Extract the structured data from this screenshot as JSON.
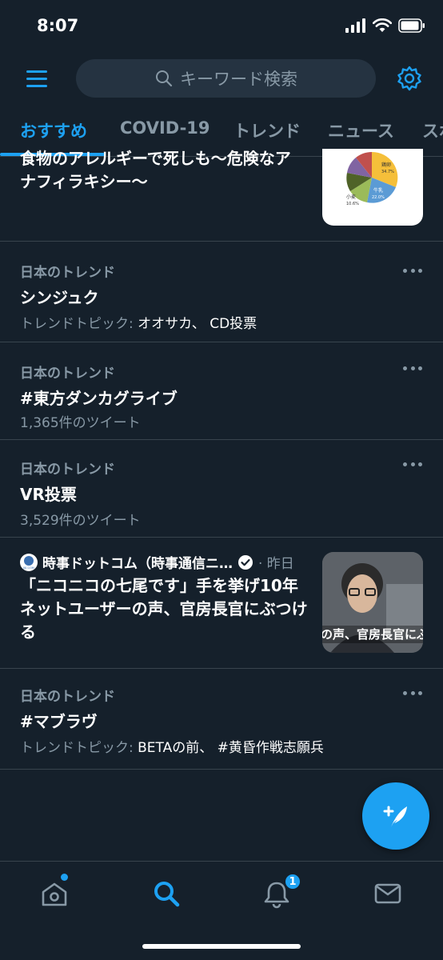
{
  "status": {
    "time": "8:07"
  },
  "search": {
    "placeholder": "キーワード検索"
  },
  "tabs": [
    {
      "label": "おすすめ",
      "active": true
    },
    {
      "label": "COVID-19"
    },
    {
      "label": "トレンド"
    },
    {
      "label": "ニュース"
    },
    {
      "label": "スポ"
    }
  ],
  "feed": {
    "top_card": {
      "title_line1": "食物のアレルギーで死しも〜危険なア",
      "title_line2": "ナフィラキシー〜"
    },
    "trends": [
      {
        "label": "日本のトレンド",
        "title": "シンジュク",
        "meta_prefix": "トレンドトピック: ",
        "meta_value": "オオサカ、 CD投票"
      },
      {
        "label": "日本のトレンド",
        "title": "#東方ダンカグライブ",
        "meta_prefix": "1,365件のツイート",
        "meta_value": ""
      },
      {
        "label": "日本のトレンド",
        "title": "VR投票",
        "meta_prefix": "3,529件のツイート",
        "meta_value": ""
      }
    ],
    "news": {
      "source": "時事ドットコム（時事通信ニ…",
      "time": "· 昨日",
      "title": "「ニコニコの七尾です」手を挙げ10年ネットユーザーの声、官房長官にぶつける",
      "thumb_caption": "の声、官房長官にぶつけて",
      "source_logo": "JIJI.COM"
    },
    "trend_last": {
      "label": "日本のトレンド",
      "title": "#マブラヴ",
      "meta_prefix": "トレンドトピック: ",
      "meta_value": "BETAの前、 #黄昏作戦志願兵"
    }
  },
  "pie_thumb": {
    "labels": [
      "鶏卵",
      "牛乳",
      "小麦"
    ],
    "values": [
      "34.7%",
      "22.0%",
      "10.6%"
    ]
  },
  "bottom_nav": {
    "notification_count": "1",
    "items": [
      "home-icon",
      "search-icon",
      "bell-icon",
      "mail-icon"
    ]
  },
  "colors": {
    "accent": "#1da1f2",
    "background": "#15202b",
    "muted": "#8899a6",
    "divider": "#38444d"
  }
}
